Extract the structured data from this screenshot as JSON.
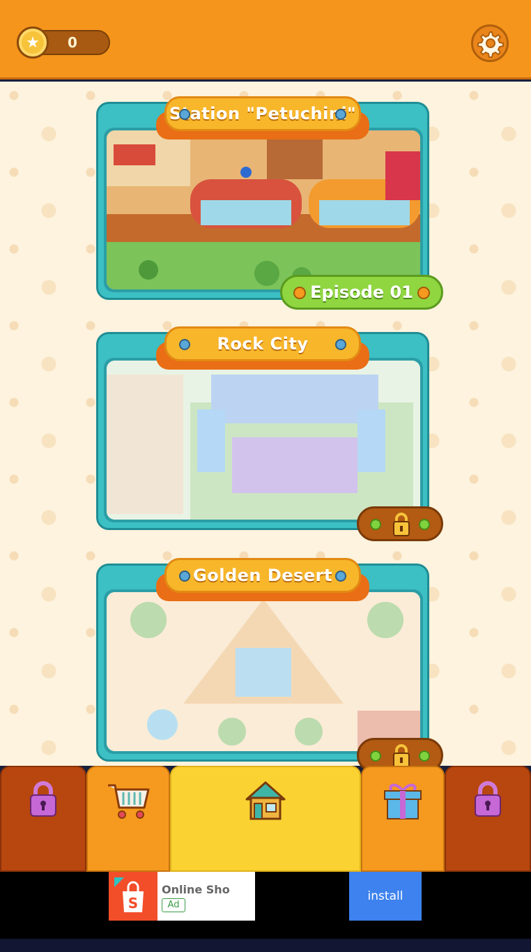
{
  "header": {
    "coin_count": "0",
    "coin_icon": "star-coin-icon",
    "settings_icon": "gear-icon"
  },
  "levels": [
    {
      "title": "Station \"Petuchini\"",
      "badge": "Episode 01",
      "locked": false
    },
    {
      "title": "Rock City",
      "locked": true
    },
    {
      "title": "Golden Desert",
      "locked": true
    }
  ],
  "nav": {
    "tabs": [
      {
        "icon": "padlock-icon",
        "locked": true
      },
      {
        "icon": "shopping-cart-icon"
      },
      {
        "icon": "house-icon",
        "active": true
      },
      {
        "icon": "gift-icon"
      },
      {
        "icon": "padlock-icon",
        "locked": true
      }
    ]
  },
  "ad": {
    "title": "Online Sho",
    "badge": "Ad",
    "install_label": "install"
  },
  "colors": {
    "header": "#f5951c",
    "card": "#3cc0c4",
    "ribbon": "#f8b62a",
    "episode_green": "#8fd641",
    "nav_home": "#fad232",
    "nav_side": "#f59a1f",
    "nav_locked": "#b8460f",
    "install_blue": "#3d82ee"
  }
}
